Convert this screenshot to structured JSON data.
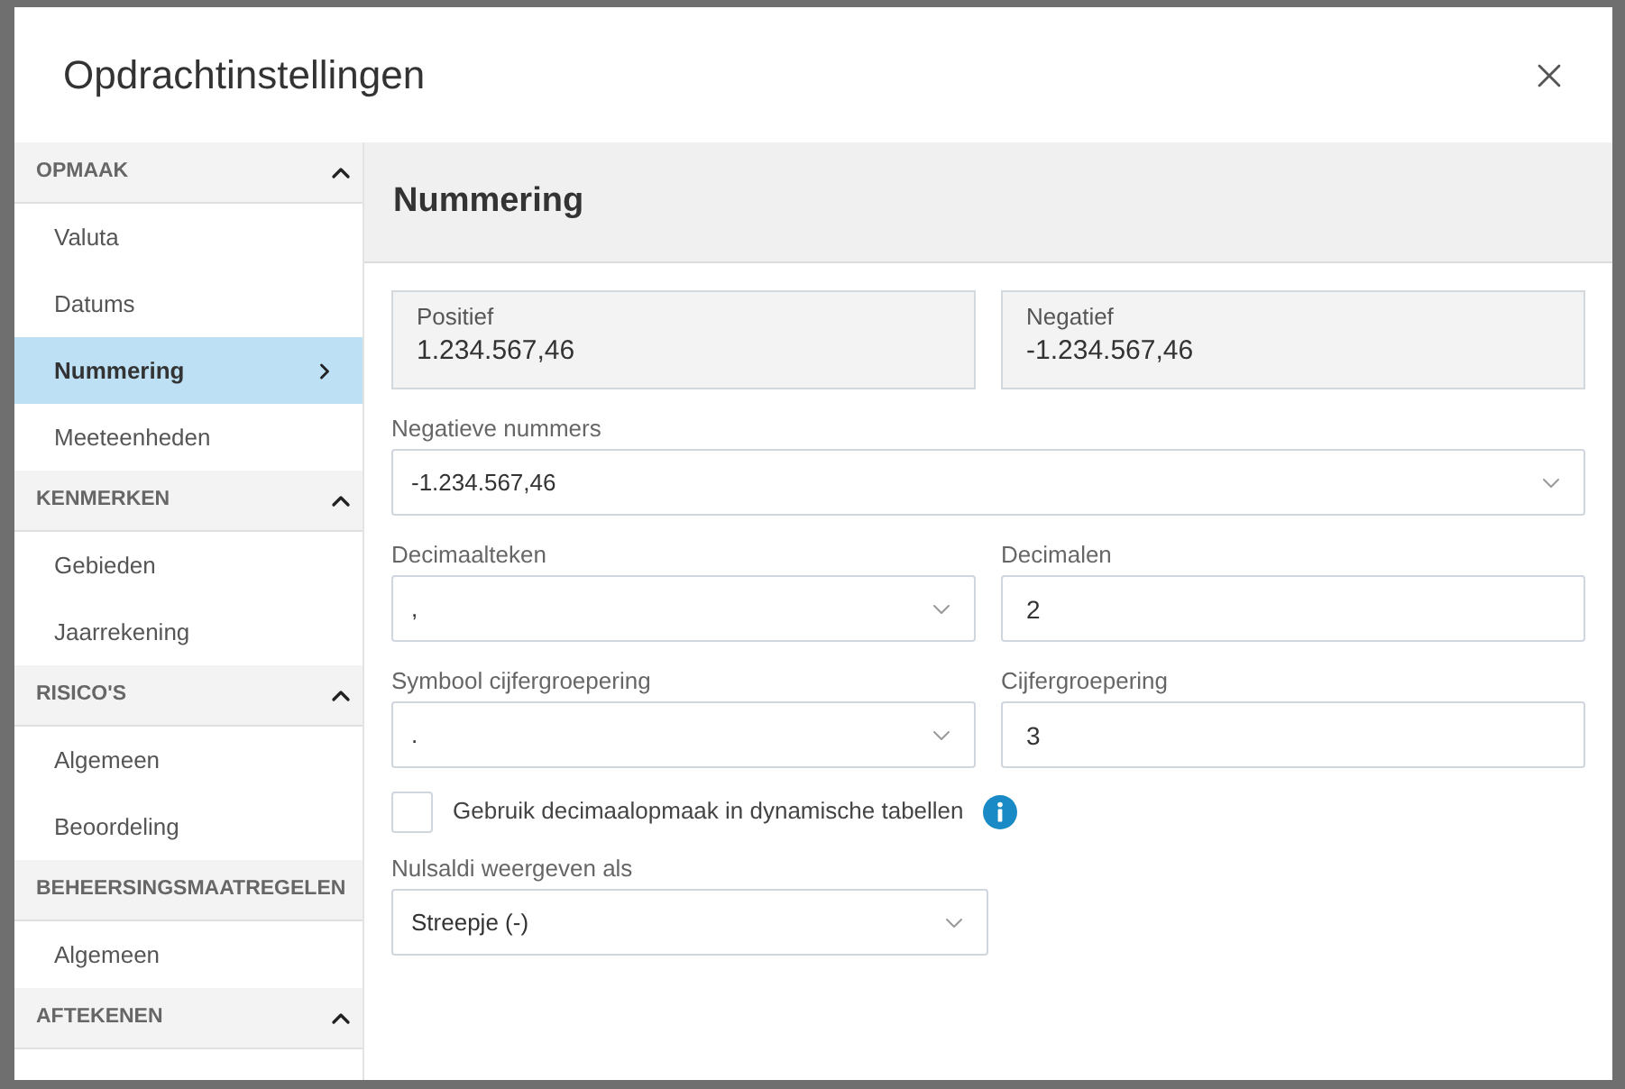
{
  "dialog": {
    "title": "Opdrachtinstellingen"
  },
  "sidebar": {
    "sections": [
      {
        "label": "OPMAAK",
        "chevron": true,
        "items": [
          {
            "label": "Valuta",
            "selected": false
          },
          {
            "label": "Datums",
            "selected": false
          },
          {
            "label": "Nummering",
            "selected": true
          },
          {
            "label": "Meeteenheden",
            "selected": false
          }
        ]
      },
      {
        "label": "KENMERKEN",
        "chevron": true,
        "items": [
          {
            "label": "Gebieden",
            "selected": false
          },
          {
            "label": "Jaarrekening",
            "selected": false
          }
        ]
      },
      {
        "label": "RISICO'S",
        "chevron": true,
        "items": [
          {
            "label": "Algemeen",
            "selected": false
          },
          {
            "label": "Beoordeling",
            "selected": false
          }
        ]
      },
      {
        "label": "BEHEERSINGSMAATREGELEN",
        "chevron": false,
        "items": [
          {
            "label": "Algemeen",
            "selected": false
          }
        ]
      },
      {
        "label": "AFTEKENEN",
        "chevron": true
      }
    ]
  },
  "content": {
    "title": "Nummering",
    "previews": [
      {
        "label": "Positief",
        "value": "1.234.567,46"
      },
      {
        "label": "Negatief",
        "value": "-1.234.567,46"
      }
    ],
    "negative_numbers": {
      "label": "Negatieve nummers",
      "value": "-1.234.567,46"
    },
    "fields": [
      {
        "kind": "select",
        "label": "Decimaalteken",
        "value": ","
      },
      {
        "kind": "input",
        "label": "Decimalen",
        "value": "2"
      },
      {
        "kind": "select",
        "label": "Symbool cijfergroepering",
        "value": "."
      },
      {
        "kind": "input",
        "label": "Cijfergroepering",
        "value": "3"
      }
    ],
    "checkbox": {
      "label": "Gebruik decimaalopmaak in dynamische tabellen",
      "checked": false
    },
    "zero_display": {
      "label": "Nulsaldi weergeven als",
      "value": "Streepje (-)"
    }
  }
}
